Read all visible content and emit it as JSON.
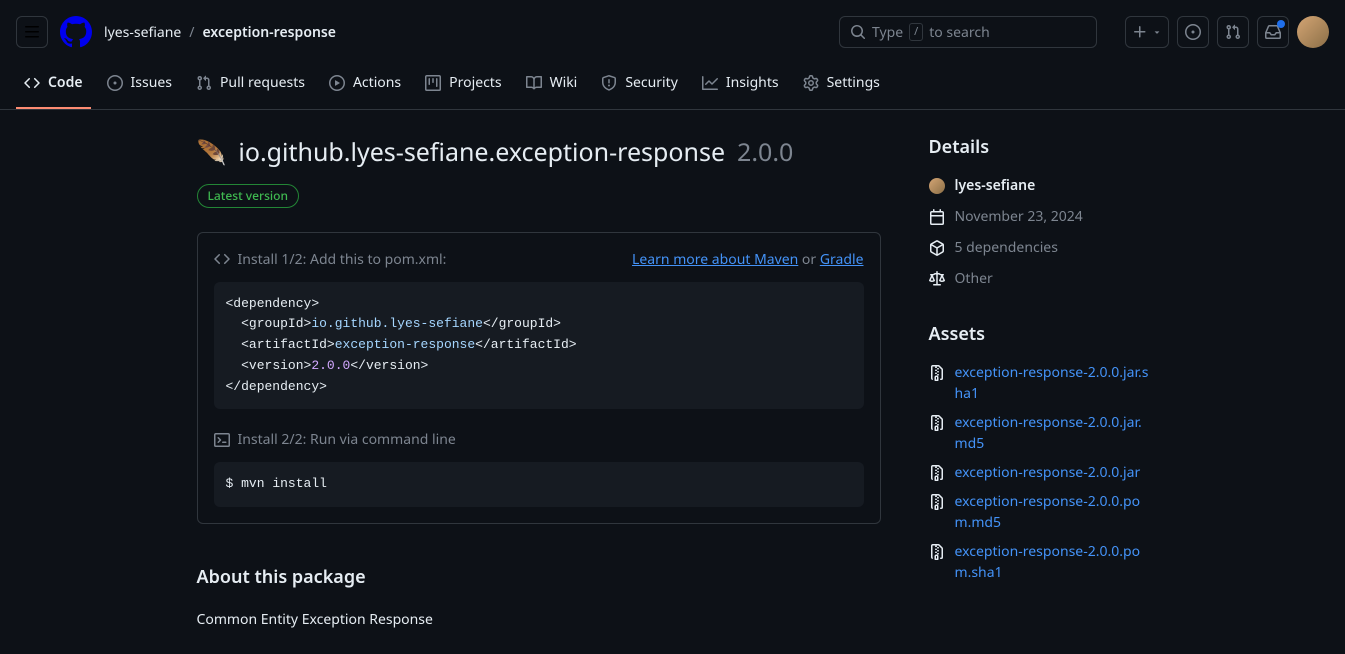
{
  "header": {
    "owner": "lyes-sefiane",
    "repo": "exception-response",
    "search_placeholder": "Type",
    "search_suffix": "to search",
    "search_kbd": "/"
  },
  "tabs": [
    {
      "label": "Code"
    },
    {
      "label": "Issues"
    },
    {
      "label": "Pull requests"
    },
    {
      "label": "Actions"
    },
    {
      "label": "Projects"
    },
    {
      "label": "Wiki"
    },
    {
      "label": "Security"
    },
    {
      "label": "Insights"
    },
    {
      "label": "Settings"
    }
  ],
  "package": {
    "name": "io.github.lyes-sefiane.exception-response",
    "version": "2.0.0",
    "badge": "Latest version"
  },
  "install": {
    "step1_label": "Install 1/2: Add this to pom.xml:",
    "learn_maven": "Learn more about Maven",
    "or": " or ",
    "gradle": "Gradle",
    "groupId": "io.github.lyes-sefiane",
    "artifactId": "exception-response",
    "version": "2.0.0",
    "step2_label": "Install 2/2: Run via command line",
    "cmd_prompt": "$ ",
    "cmd": "mvn install"
  },
  "about": {
    "heading": "About this package",
    "description": "Common Entity Exception Response"
  },
  "details": {
    "heading": "Details",
    "author": "lyes-sefiane",
    "date": "November 23, 2024",
    "deps": "5 dependencies",
    "license": "Other"
  },
  "assets": {
    "heading": "Assets",
    "items": [
      "exception-response-2.0.0.jar.sha1",
      "exception-response-2.0.0.jar.md5",
      "exception-response-2.0.0.jar",
      "exception-response-2.0.0.pom.md5",
      "exception-response-2.0.0.pom.sha1"
    ]
  }
}
